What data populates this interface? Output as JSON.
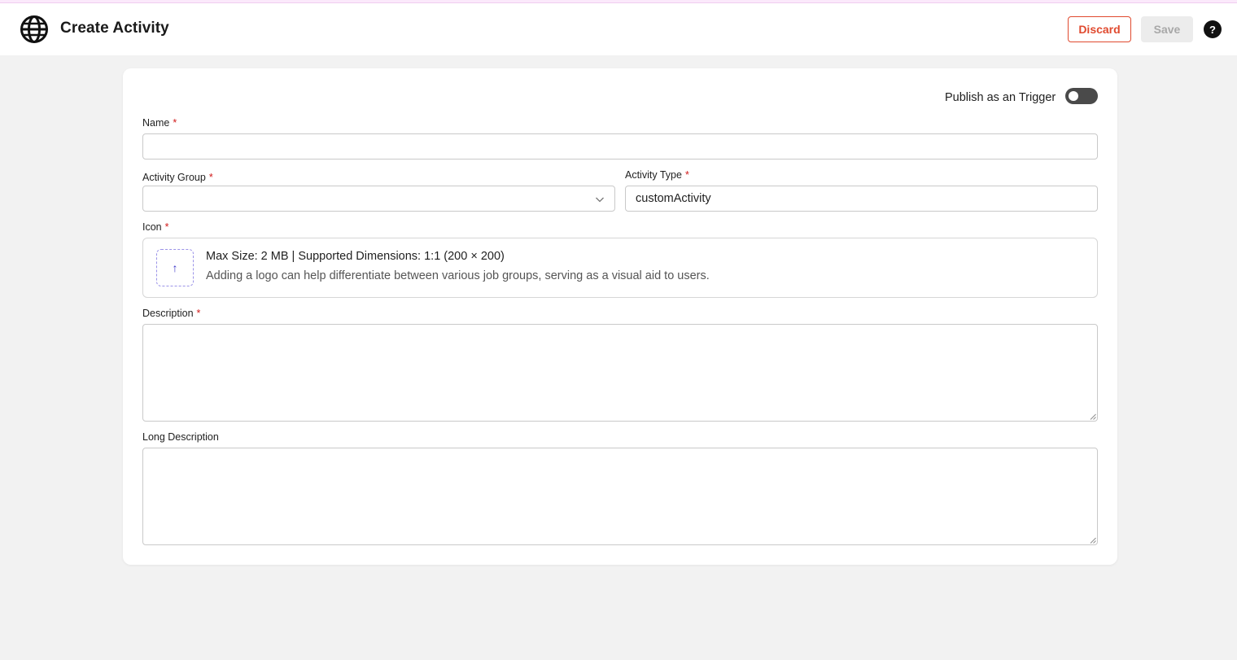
{
  "header": {
    "title": "Create Activity",
    "discard_label": "Discard",
    "save_label": "Save",
    "help_label": "?"
  },
  "form": {
    "publish_label": "Publish as an Trigger",
    "publish_toggle_on": false,
    "name": {
      "label": "Name",
      "value": ""
    },
    "activity_group": {
      "label": "Activity Group",
      "value": ""
    },
    "activity_type": {
      "label": "Activity Type",
      "value": "customActivity"
    },
    "icon": {
      "label": "Icon",
      "upload_glyph": "↑",
      "hint_main": "Max Size: 2 MB | Supported Dimensions: 1:1 (200 × 200)",
      "hint_sub": "Adding a logo can help differentiate between various job groups, serving as a visual aid to users."
    },
    "description": {
      "label": "Description",
      "value": ""
    },
    "long_description": {
      "label": "Long Description",
      "value": ""
    },
    "required_marker": "*"
  },
  "colors": {
    "accent_discard": "#e04a2f",
    "required": "#d11a1a",
    "toggle_off": "#4a4a4a",
    "upload_accent": "#3b35c9"
  }
}
